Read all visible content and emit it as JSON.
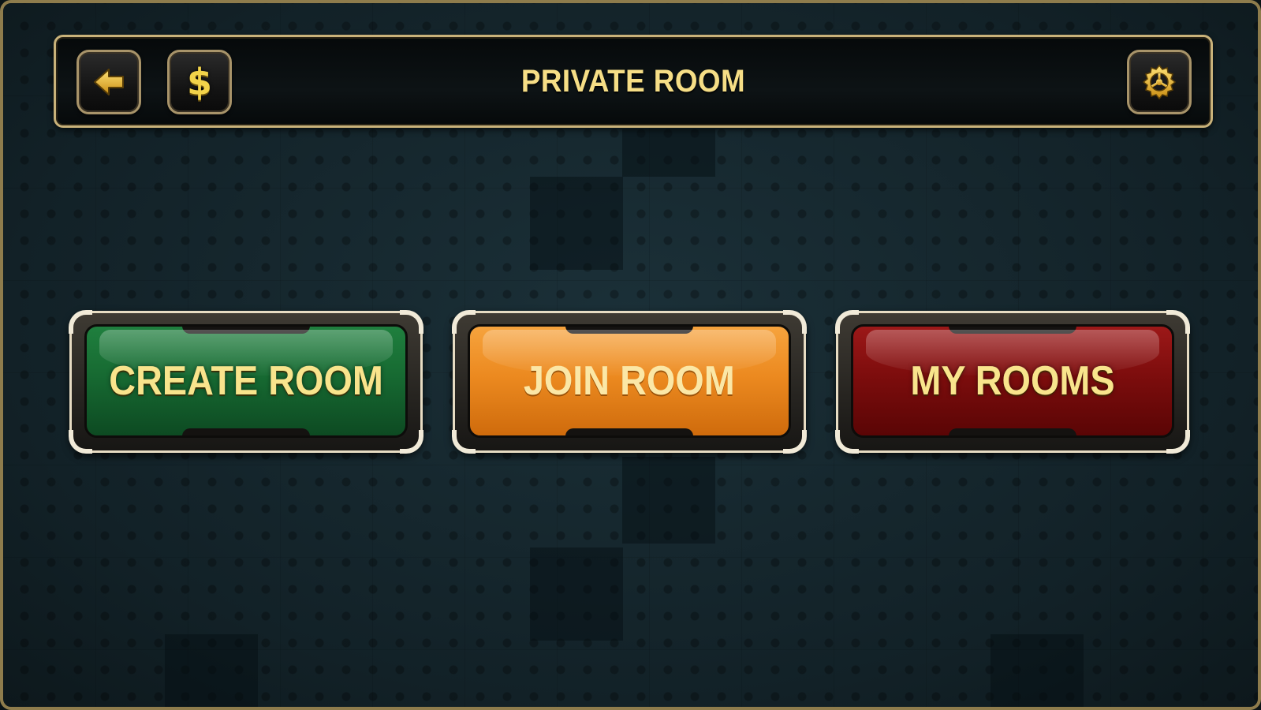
{
  "header": {
    "title": "PRIVATE ROOM",
    "back_icon": "arrow-left-icon",
    "coin_icon": "dollar-icon",
    "coin_symbol": "$",
    "settings_icon": "gear-icon"
  },
  "actions": {
    "create_room": "CREATE ROOM",
    "join_room": "JOIN ROOM",
    "my_rooms": "MY ROOMS"
  },
  "colors": {
    "gold_text": "#f6de86",
    "create_green": "#176a32",
    "join_orange": "#ec8a20",
    "my_rooms_red": "#7d0d0d",
    "frame_gold": "#c9b27a",
    "background": "#15262c"
  }
}
